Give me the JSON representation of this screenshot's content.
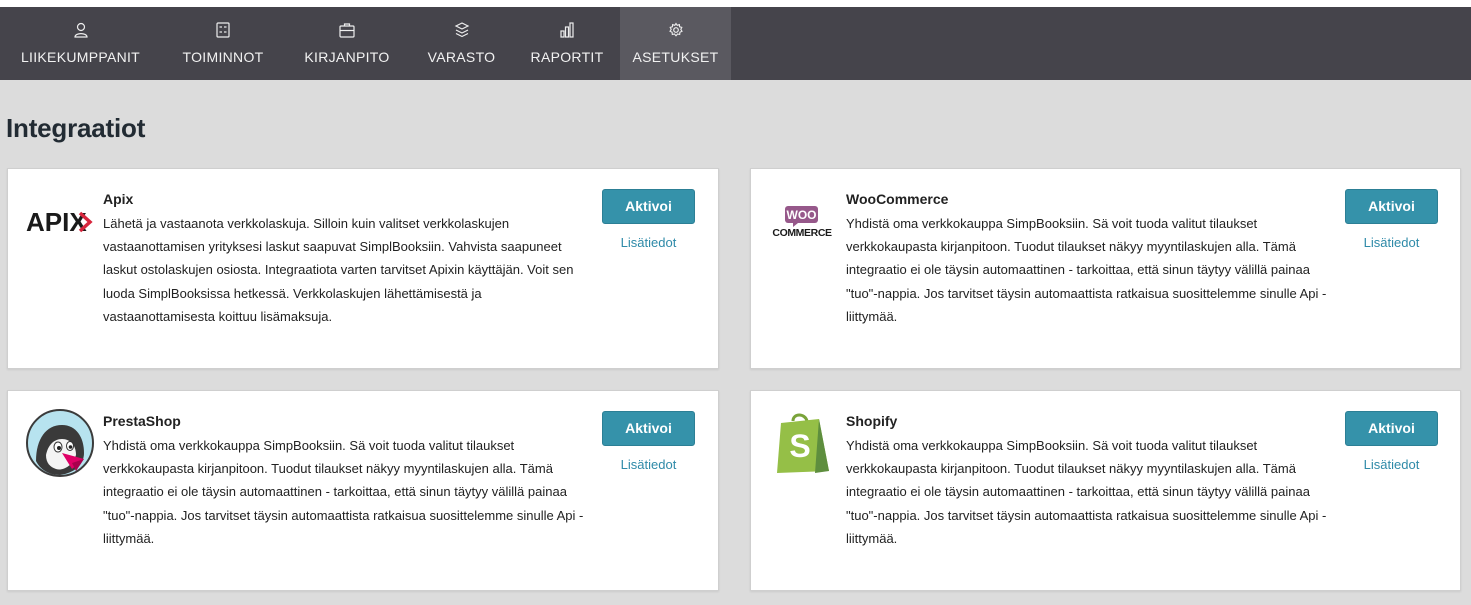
{
  "nav": {
    "items": [
      {
        "label": "LIIKEKUMPPANIT",
        "icon": "user-icon"
      },
      {
        "label": "TOIMINNOT",
        "icon": "calculator-icon"
      },
      {
        "label": "KIRJANPITO",
        "icon": "briefcase-icon"
      },
      {
        "label": "VARASTO",
        "icon": "boxes-icon"
      },
      {
        "label": "RAPORTIT",
        "icon": "bar-chart-icon"
      },
      {
        "label": "ASETUKSET",
        "icon": "gear-icon",
        "active": true
      }
    ]
  },
  "page": {
    "title": "Integraatiot"
  },
  "integrations": [
    {
      "name": "Apix",
      "logo": "apix-logo",
      "logo_text": "APIX",
      "description": "Lähetä ja vastaanota verkkolaskuja. Silloin kuin valitset verkkolaskujen vastaanottamisen yrityksesi laskut saapuvat SimplBooksiin. Vahvista saapuneet laskut ostolaskujen osiosta. Integraatiota varten tarvitset Apixin käyttäjän. Voit sen luoda SimplBooksissa hetkessä. Verkkolaskujen lähettämisestä ja vastaanottamisesta koittuu lisämaksuja.",
      "activate_label": "Aktivoi",
      "more_label": "Lisätiedot"
    },
    {
      "name": "WooCommerce",
      "logo": "woocommerce-logo",
      "logo_text_top": "WOO",
      "logo_text_bottom": "COMMERCE",
      "description": "Yhdistä oma verkkokauppa SimpBooksiin. Sä voit tuoda valitut tilaukset verkkokaupasta kirjanpitoon. Tuodut tilaukset näkyy myyntilaskujen alla. Tämä integraatio ei ole täysin automaattinen - tarkoittaa, että sinun täytyy välillä painaa \"tuo\"-nappia. Jos tarvitset täysin automaattista ratkaisua suosittelemme sinulle Api -liittymää.",
      "activate_label": "Aktivoi",
      "more_label": "Lisätiedot"
    },
    {
      "name": "PrestaShop",
      "logo": "prestashop-logo",
      "description": "Yhdistä oma verkkokauppa SimpBooksiin. Sä voit tuoda valitut tilaukset verkkokaupasta kirjanpitoon. Tuodut tilaukset näkyy myyntilaskujen alla. Tämä integraatio ei ole täysin automaattinen - tarkoittaa, että sinun täytyy välillä painaa \"tuo\"-nappia. Jos tarvitset täysin automaattista ratkaisua suosittelemme sinulle Api -liittymää.",
      "activate_label": "Aktivoi",
      "more_label": "Lisätiedot"
    },
    {
      "name": "Shopify",
      "logo": "shopify-logo",
      "logo_text": "S",
      "description": "Yhdistä oma verkkokauppa SimpBooksiin. Sä voit tuoda valitut tilaukset verkkokaupasta kirjanpitoon. Tuodut tilaukset näkyy myyntilaskujen alla. Tämä integraatio ei ole täysin automaattinen - tarkoittaa, että sinun täytyy välillä painaa \"tuo\"-nappia. Jos tarvitset täysin automaattista ratkaisua suosittelemme sinulle Api -liittymää.",
      "activate_label": "Aktivoi",
      "more_label": "Lisätiedot"
    }
  ],
  "colors": {
    "nav_bg": "#45444b",
    "nav_active": "#5a5960",
    "page_bg": "#dcdcdc",
    "button": "#3592aa",
    "link": "#2e8aa8",
    "woo_purple": "#96588a",
    "shopify_green": "#95bf47"
  }
}
